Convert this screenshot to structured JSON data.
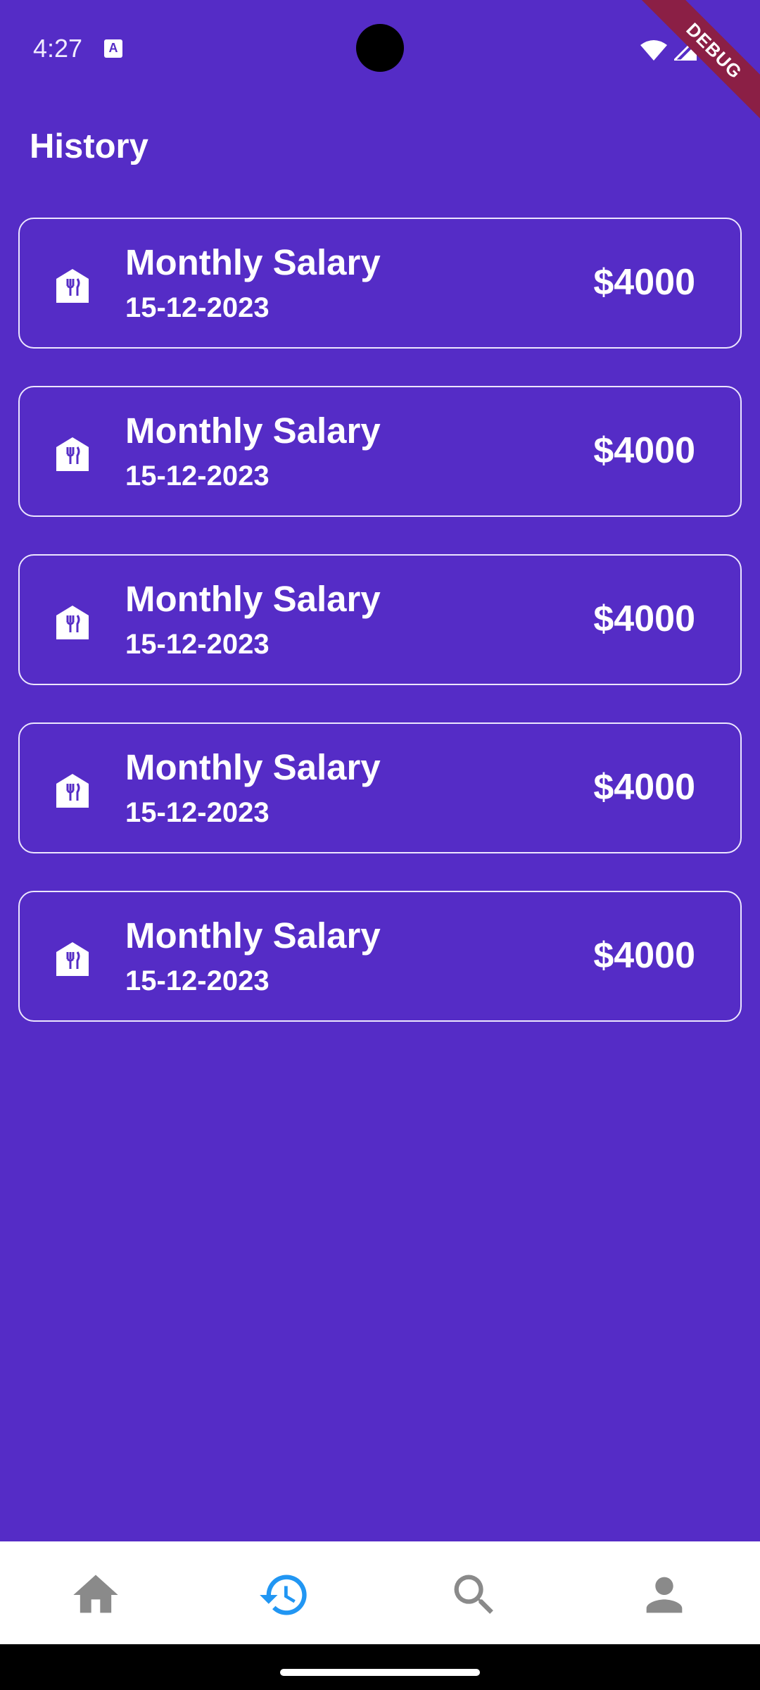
{
  "status_bar": {
    "time": "4:27",
    "debug_label": "DEBUG"
  },
  "header": {
    "title": "History"
  },
  "transactions": [
    {
      "title": "Monthly Salary",
      "date": "15-12-2023",
      "amount": "$4000",
      "icon": "restaurant-tag-icon"
    },
    {
      "title": "Monthly Salary",
      "date": "15-12-2023",
      "amount": "$4000",
      "icon": "restaurant-tag-icon"
    },
    {
      "title": "Monthly Salary",
      "date": "15-12-2023",
      "amount": "$4000",
      "icon": "restaurant-tag-icon"
    },
    {
      "title": "Monthly Salary",
      "date": "15-12-2023",
      "amount": "$4000",
      "icon": "restaurant-tag-icon"
    },
    {
      "title": "Monthly Salary",
      "date": "15-12-2023",
      "amount": "$4000",
      "icon": "restaurant-tag-icon"
    }
  ],
  "bottom_nav": {
    "items": [
      {
        "icon": "home-icon",
        "active": false
      },
      {
        "icon": "history-icon",
        "active": true
      },
      {
        "icon": "search-icon",
        "active": false
      },
      {
        "icon": "person-icon",
        "active": false
      }
    ]
  },
  "colors": {
    "background": "#552cc6",
    "active_nav": "#2196f3",
    "inactive_nav": "#8a8a8a",
    "debug_banner": "#8b1f45"
  }
}
